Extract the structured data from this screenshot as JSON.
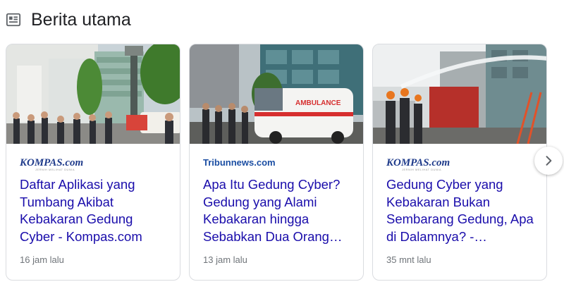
{
  "section": {
    "title": "Berita utama",
    "icon": "news-icon"
  },
  "cards": [
    {
      "source": "KOMPAS.com",
      "source_tagline": "JERNIH MELIHAT DUNIA",
      "headline": "Daftar Aplikasi yang Tumbang Akibat Kebakaran Gedung Cyber - Kompas.com",
      "time": "16 jam lalu"
    },
    {
      "source": "Tribunnews.com",
      "headline": "Apa Itu Gedung Cyber? Gedung yang Alami Kebakaran hingga Sebabkan Dua Orang…",
      "time": "13 jam lalu",
      "thumb_text": "AMBULANCE"
    },
    {
      "source": "KOMPAS.com",
      "source_tagline": "JERNIH MELIHAT DUNIA",
      "headline": "Gedung Cyber yang Kebakaran Bukan Sembarang Gedung, Apa di Dalamnya? -…",
      "time": "35 mnt lalu"
    }
  ],
  "next_button": {
    "icon": "chevron-right-icon"
  },
  "colors": {
    "headline": "#1a0dab",
    "meta": "#70757a",
    "border": "#dadce0"
  }
}
